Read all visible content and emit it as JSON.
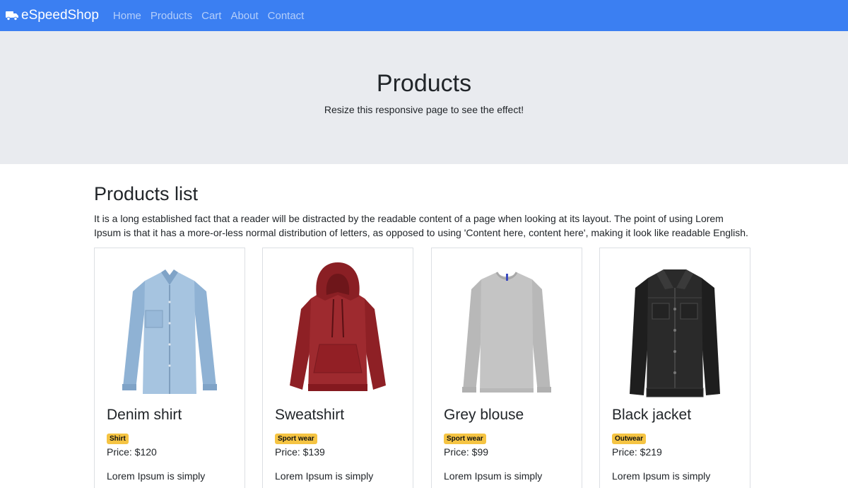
{
  "navbar": {
    "brand": "eSpeedShop",
    "links": [
      "Home",
      "Products",
      "Cart",
      "About",
      "Contact"
    ]
  },
  "hero": {
    "title": "Products",
    "subtitle": "Resize this responsive page to see the effect!"
  },
  "section": {
    "title": "Products list",
    "intro": "It is a long established fact that a reader will be distracted by the readable content of a page when looking at its layout. The point of using Lorem Ipsum is that it has a more-or-less normal distribution of letters, as opposed to using 'Content here, content here', making it look like readable English."
  },
  "products": [
    {
      "name": "Denim shirt",
      "badge": "Shirt",
      "price": "Price: $120",
      "desc": "Lorem Ipsum is simply"
    },
    {
      "name": "Sweatshirt",
      "badge": "Sport wear",
      "price": "Price: $139",
      "desc": "Lorem Ipsum is simply"
    },
    {
      "name": "Grey blouse",
      "badge": "Sport wear",
      "price": "Price: $99",
      "desc": "Lorem Ipsum is simply"
    },
    {
      "name": "Black jacket",
      "badge": "Outwear",
      "price": "Price: $219",
      "desc": "Lorem Ipsum is simply"
    }
  ],
  "colors": {
    "navbar": "#3b7ff2",
    "hero": "#e9ebef",
    "badge": "#f5c443"
  },
  "icons": {
    "brand": "truck-icon"
  }
}
